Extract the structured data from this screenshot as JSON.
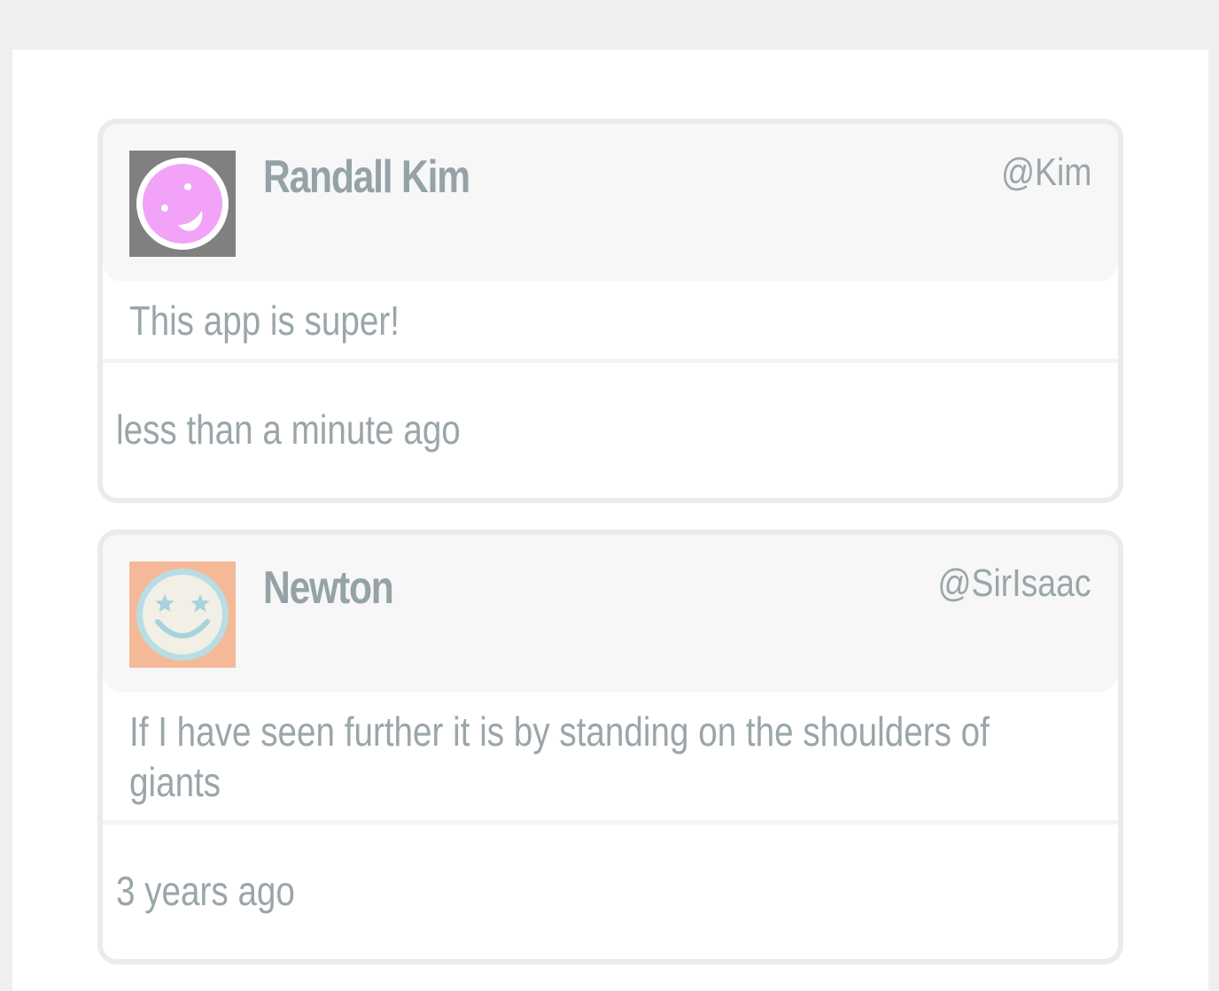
{
  "posts": [
    {
      "author": "Randall Kim",
      "handle": "@Kim",
      "message": "This app is super!",
      "time": "less than a minute ago",
      "avatar": {
        "icon": "winking-face-icon",
        "background": "#808080",
        "face_color": "#f2a3f7"
      }
    },
    {
      "author": "Newton",
      "handle": "@SirIsaac",
      "message": "If I have seen further it is by standing on the shoulders of giants",
      "time": "3 years ago",
      "avatar": {
        "icon": "star-eyes-face-icon",
        "background": "#f5b998",
        "face_color": "#f1efe6",
        "ring_color": "#b8dde3"
      }
    }
  ]
}
